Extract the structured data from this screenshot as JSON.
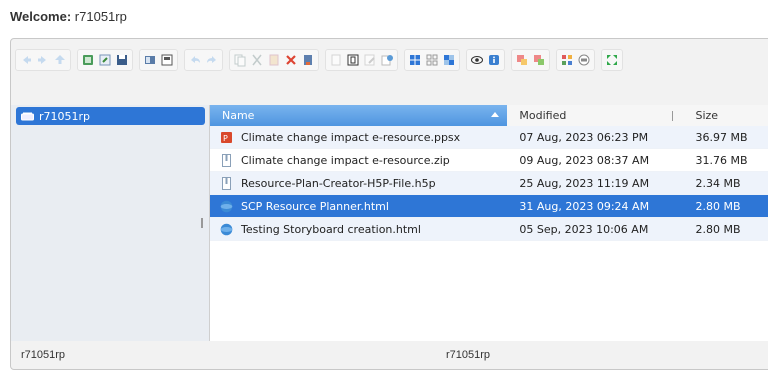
{
  "header": {
    "welcome_label": "Welcome:",
    "username": "r71051rp"
  },
  "toolbar": {
    "groups": [
      [
        "back-icon",
        "forward-icon",
        "up-icon"
      ],
      [
        "reload-icon",
        "home-icon",
        "save-icon"
      ],
      [
        "open-icon",
        "download-icon"
      ],
      [
        "undo-icon",
        "redo-icon"
      ],
      [
        "copy-icon",
        "cut-icon",
        "paste-icon",
        "delete-icon",
        "empty-icon"
      ],
      [
        "duplicate-icon",
        "rename-icon",
        "edit-icon",
        "properties-icon"
      ],
      [
        "icons-view-icon",
        "list-view-icon",
        "details-view-icon"
      ],
      [
        "preview-icon",
        "info-icon"
      ],
      [
        "extract-icon",
        "archive-icon"
      ],
      [
        "select-all-icon",
        "settings-icon"
      ],
      [
        "fullscreen-icon"
      ]
    ]
  },
  "tree": {
    "root_label": "r71051rp"
  },
  "columns": {
    "name": "Name",
    "modified": "Modified",
    "size": "Size"
  },
  "files": [
    {
      "name": "Climate change impact e-resource.ppsx",
      "modified": "07 Aug, 2023 06:23 PM",
      "size": "36.97 MB",
      "icon": "ppsx-icon"
    },
    {
      "name": "Climate change impact e-resource.zip",
      "modified": "09 Aug, 2023 08:37 AM",
      "size": "31.76 MB",
      "icon": "zip-icon"
    },
    {
      "name": "Resource-Plan-Creator-H5P-File.h5p",
      "modified": "25 Aug, 2023 11:19 AM",
      "size": "2.34 MB",
      "icon": "h5p-icon"
    },
    {
      "name": "SCP Resource Planner.html",
      "modified": "31 Aug, 2023 09:24 AM",
      "size": "2.80 MB",
      "icon": "html-icon",
      "selected": true
    },
    {
      "name": "Testing Storyboard creation.html",
      "modified": "05 Sep, 2023 10:06 AM",
      "size": "2.80 MB",
      "icon": "html-icon"
    }
  ],
  "status": {
    "left": "r71051rp",
    "center": "r71051rp"
  },
  "colors": {
    "selection": "#2e76d6",
    "header_active": "#4e95e0"
  }
}
